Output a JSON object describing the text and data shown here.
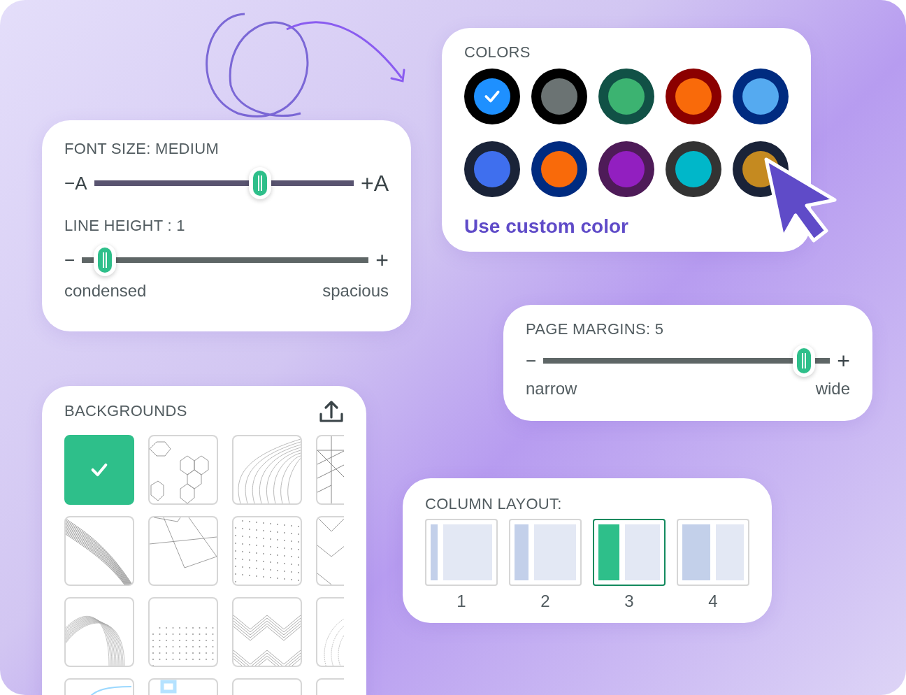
{
  "font_size": {
    "label": "FONT SIZE: MEDIUM",
    "decrease": "−A",
    "increase": "+A",
    "level": 0.64
  },
  "line_height": {
    "label": "LINE HEIGHT : 1",
    "decrease": "−",
    "increase": "+",
    "level": 0.08,
    "min_label": "condensed",
    "max_label": "spacious"
  },
  "colors": {
    "label": "COLORS",
    "swatches": [
      {
        "color": "#1e90ff",
        "ring": {
          "color": "#000000"
        },
        "selected": true
      },
      {
        "color": "#6b7373",
        "ring": {
          "color": "#000000"
        },
        "selected": false
      },
      {
        "color": "#3cb371",
        "ring": {
          "color": "#115146"
        },
        "selected": false
      },
      {
        "color": "#f96a0a",
        "ring": {
          "color": "#8b0000"
        },
        "selected": false
      },
      {
        "color": "#55aaf0",
        "ring": {
          "color": "#002b80"
        },
        "selected": false
      },
      {
        "color": "#3f6fee",
        "ring": {
          "color": "#1a2338"
        },
        "selected": false
      },
      {
        "color": "#f96a0a",
        "ring": {
          "color": "#002b80"
        },
        "selected": false
      },
      {
        "color": "#921fc0",
        "ring": {
          "color": "#4e1b58"
        },
        "selected": false
      },
      {
        "color": "#00b7c9",
        "ring": {
          "color": "#333333"
        },
        "selected": false
      },
      {
        "color": "#c58a20",
        "ring": {
          "color": "#1a2338"
        },
        "selected": false
      }
    ],
    "custom_link": "Use custom color"
  },
  "page_margins": {
    "label": "PAGE MARGINS: 5",
    "decrease": "−",
    "increase": "+",
    "level": 0.91,
    "min_label": "narrow",
    "max_label": "wide"
  },
  "backgrounds": {
    "label": "BACKGROUNDS",
    "tiles": [
      {
        "kind": "solid",
        "selected": true
      },
      {
        "kind": "hexagons",
        "selected": false
      },
      {
        "kind": "contours",
        "selected": false
      },
      {
        "kind": "triangles",
        "selected": false
      },
      {
        "kind": "diagonals",
        "selected": false
      },
      {
        "kind": "polygons",
        "selected": false
      },
      {
        "kind": "dots",
        "selected": false
      },
      {
        "kind": "chevrons",
        "selected": false
      },
      {
        "kind": "curves",
        "selected": false
      },
      {
        "kind": "dotgrid",
        "selected": false
      },
      {
        "kind": "zigzag",
        "selected": false
      },
      {
        "kind": "arcs",
        "selected": false
      },
      {
        "kind": "circle",
        "selected": false
      },
      {
        "kind": "squares",
        "selected": false
      },
      {
        "kind": "plain",
        "selected": false
      },
      {
        "kind": "plain",
        "selected": false
      }
    ]
  },
  "column_layout": {
    "label": "COLUMN LAYOUT:",
    "options": [
      {
        "label": "1",
        "selected": false
      },
      {
        "label": "2",
        "selected": false
      },
      {
        "label": "3",
        "selected": true
      },
      {
        "label": "4",
        "selected": false
      }
    ]
  }
}
